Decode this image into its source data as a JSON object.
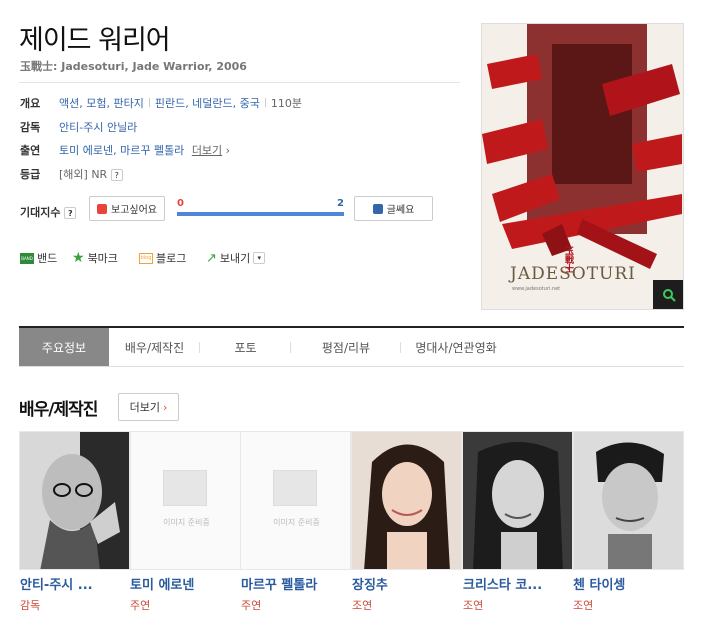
{
  "movie": {
    "title": "제이드 워리어",
    "subtitle": "玉戰士: Jadesoturi, Jade Warrior, 2006"
  },
  "info": {
    "overview_label": "개요",
    "genres": "액션, 모험, 판타지",
    "countries": "핀란드, 네덜란드, 중국",
    "runtime": "110분",
    "director_label": "감독",
    "director": "안티-주시 안닐라",
    "cast_label": "출연",
    "cast": "토미 에로넨, 마르꾸 펠톨라",
    "cast_more": "더보기",
    "rating_label": "등급",
    "rating_prefix": "[해외]",
    "rating": "NR",
    "rating_help": "?"
  },
  "expect": {
    "label": "기대지수",
    "help": "?",
    "want_label": "보고싶어요",
    "want_count": "0",
    "skip_count": "2",
    "skip_label": "글쎄요",
    "want_fraction": 0.0
  },
  "social": {
    "band": "밴드",
    "band_icon_text": "BAND",
    "bookmark": "북마크",
    "blog": "블로그",
    "blog_icon_text": "blog",
    "send": "보내기"
  },
  "poster": {
    "title_text": "JADESOTURI",
    "chinese_text": "玉戰士",
    "site": "www.jadesoturi.net"
  },
  "tabs": [
    "주요정보",
    "배우/제작진",
    "포토",
    "평점/리뷰",
    "명대사/연관영화"
  ],
  "section": {
    "title": "배우/제작진",
    "more": "더보기"
  },
  "people": [
    {
      "name": "안티-주시 ...",
      "role": "감독",
      "photo": true
    },
    {
      "name": "토미 에로넨",
      "role": "주연",
      "photo": false,
      "placeholder": "이미지 준비중"
    },
    {
      "name": "마르꾸 펠톨라",
      "role": "주연",
      "photo": false,
      "placeholder": "이미지 준비중"
    },
    {
      "name": "장징추",
      "role": "조연",
      "photo": true
    },
    {
      "name": "크리스타 코...",
      "role": "조연",
      "photo": true
    },
    {
      "name": "첸 타이셍",
      "role": "조연",
      "photo": true
    }
  ],
  "colors": {
    "accent": "#3366aa",
    "red": "#e8443a",
    "role": "#cc4a3a"
  }
}
